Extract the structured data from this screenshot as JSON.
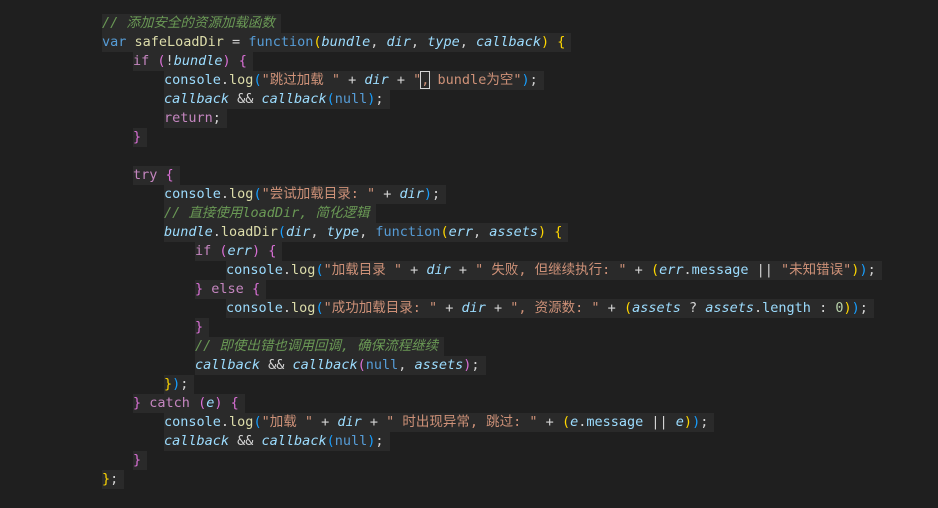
{
  "editor": {
    "language": "javascript",
    "lines": [
      {
        "indent": 1,
        "tokens": [
          {
            "t": "// 添加安全的资源加载函数",
            "c": "cmt"
          }
        ]
      },
      {
        "indent": 1,
        "tokens": [
          {
            "t": "var ",
            "c": "kwb"
          },
          {
            "t": "safeLoadDir",
            "c": "fn"
          },
          {
            "t": " = ",
            "c": "op"
          },
          {
            "t": "function",
            "c": "kwb"
          },
          {
            "t": "(",
            "c": "b1"
          },
          {
            "t": "bundle",
            "c": "param"
          },
          {
            "t": ", ",
            "c": "punc"
          },
          {
            "t": "dir",
            "c": "param"
          },
          {
            "t": ", ",
            "c": "punc"
          },
          {
            "t": "type",
            "c": "param"
          },
          {
            "t": ", ",
            "c": "punc"
          },
          {
            "t": "callback",
            "c": "param"
          },
          {
            "t": ")",
            "c": "b1"
          },
          {
            "t": " ",
            "c": "punc"
          },
          {
            "t": "{",
            "c": "b1"
          }
        ]
      },
      {
        "indent": 2,
        "tokens": [
          {
            "t": "if",
            "c": "kw"
          },
          {
            "t": " ",
            "c": "punc"
          },
          {
            "t": "(",
            "c": "b2"
          },
          {
            "t": "!",
            "c": "op"
          },
          {
            "t": "bundle",
            "c": "param"
          },
          {
            "t": ")",
            "c": "b2"
          },
          {
            "t": " ",
            "c": "punc"
          },
          {
            "t": "{",
            "c": "b2"
          }
        ]
      },
      {
        "indent": 3,
        "tokens": [
          {
            "t": "console",
            "c": "var"
          },
          {
            "t": ".",
            "c": "punc"
          },
          {
            "t": "log",
            "c": "fn"
          },
          {
            "t": "(",
            "c": "b3"
          },
          {
            "t": "\"跳过加载 \"",
            "c": "str"
          },
          {
            "t": " + ",
            "c": "op"
          },
          {
            "t": "dir",
            "c": "param"
          },
          {
            "t": " + ",
            "c": "op"
          },
          {
            "t": "\"",
            "c": "str"
          },
          {
            "t": ",",
            "c": "str",
            "box": true
          },
          {
            "t": " bundle为空\"",
            "c": "str"
          },
          {
            "t": ")",
            "c": "b3"
          },
          {
            "t": ";",
            "c": "punc"
          }
        ]
      },
      {
        "indent": 3,
        "tokens": [
          {
            "t": "callback",
            "c": "param"
          },
          {
            "t": " && ",
            "c": "op"
          },
          {
            "t": "callback",
            "c": "param"
          },
          {
            "t": "(",
            "c": "b3"
          },
          {
            "t": "null",
            "c": "kwb"
          },
          {
            "t": ")",
            "c": "b3"
          },
          {
            "t": ";",
            "c": "punc"
          }
        ]
      },
      {
        "indent": 3,
        "tokens": [
          {
            "t": "return",
            "c": "kw"
          },
          {
            "t": ";",
            "c": "punc"
          }
        ]
      },
      {
        "indent": 2,
        "tokens": [
          {
            "t": "}",
            "c": "b2"
          }
        ]
      },
      {
        "indent": 2,
        "blank": true,
        "tokens": []
      },
      {
        "indent": 2,
        "tokens": [
          {
            "t": "try",
            "c": "kw"
          },
          {
            "t": " ",
            "c": "punc"
          },
          {
            "t": "{",
            "c": "b2"
          }
        ]
      },
      {
        "indent": 3,
        "tokens": [
          {
            "t": "console",
            "c": "var"
          },
          {
            "t": ".",
            "c": "punc"
          },
          {
            "t": "log",
            "c": "fn"
          },
          {
            "t": "(",
            "c": "b3"
          },
          {
            "t": "\"尝试加载目录: \"",
            "c": "str"
          },
          {
            "t": " + ",
            "c": "op"
          },
          {
            "t": "dir",
            "c": "param"
          },
          {
            "t": ")",
            "c": "b3"
          },
          {
            "t": ";",
            "c": "punc"
          }
        ]
      },
      {
        "indent": 3,
        "tokens": [
          {
            "t": "// 直接使用loadDir, 简化逻辑",
            "c": "cmt"
          }
        ]
      },
      {
        "indent": 3,
        "tokens": [
          {
            "t": "bundle",
            "c": "param"
          },
          {
            "t": ".",
            "c": "punc"
          },
          {
            "t": "loadDir",
            "c": "fn"
          },
          {
            "t": "(",
            "c": "b3"
          },
          {
            "t": "dir",
            "c": "param"
          },
          {
            "t": ", ",
            "c": "punc"
          },
          {
            "t": "type",
            "c": "param"
          },
          {
            "t": ", ",
            "c": "punc"
          },
          {
            "t": "function",
            "c": "kwb"
          },
          {
            "t": "(",
            "c": "b1"
          },
          {
            "t": "err",
            "c": "param"
          },
          {
            "t": ", ",
            "c": "punc"
          },
          {
            "t": "assets",
            "c": "param"
          },
          {
            "t": ")",
            "c": "b1"
          },
          {
            "t": " ",
            "c": "punc"
          },
          {
            "t": "{",
            "c": "b1"
          }
        ]
      },
      {
        "indent": 4,
        "tokens": [
          {
            "t": "if",
            "c": "kw"
          },
          {
            "t": " ",
            "c": "punc"
          },
          {
            "t": "(",
            "c": "b2"
          },
          {
            "t": "err",
            "c": "param"
          },
          {
            "t": ")",
            "c": "b2"
          },
          {
            "t": " ",
            "c": "punc"
          },
          {
            "t": "{",
            "c": "b2"
          }
        ]
      },
      {
        "indent": 5,
        "tokens": [
          {
            "t": "console",
            "c": "var"
          },
          {
            "t": ".",
            "c": "punc"
          },
          {
            "t": "log",
            "c": "fn"
          },
          {
            "t": "(",
            "c": "b3"
          },
          {
            "t": "\"加载目录 \"",
            "c": "str"
          },
          {
            "t": " + ",
            "c": "op"
          },
          {
            "t": "dir",
            "c": "param"
          },
          {
            "t": " + ",
            "c": "op"
          },
          {
            "t": "\" 失败, 但继续执行: \"",
            "c": "str"
          },
          {
            "t": " + ",
            "c": "op"
          },
          {
            "t": "(",
            "c": "b1"
          },
          {
            "t": "err",
            "c": "param"
          },
          {
            "t": ".",
            "c": "punc"
          },
          {
            "t": "message",
            "c": "prop"
          },
          {
            "t": " || ",
            "c": "op"
          },
          {
            "t": "\"未知错误\"",
            "c": "str"
          },
          {
            "t": ")",
            "c": "b1"
          },
          {
            "t": ")",
            "c": "b3"
          },
          {
            "t": ";",
            "c": "punc"
          }
        ]
      },
      {
        "indent": 4,
        "tokens": [
          {
            "t": "}",
            "c": "b2"
          },
          {
            "t": " ",
            "c": "punc"
          },
          {
            "t": "else",
            "c": "kw"
          },
          {
            "t": " ",
            "c": "punc"
          },
          {
            "t": "{",
            "c": "b2"
          }
        ]
      },
      {
        "indent": 5,
        "tokens": [
          {
            "t": "console",
            "c": "var"
          },
          {
            "t": ".",
            "c": "punc"
          },
          {
            "t": "log",
            "c": "fn"
          },
          {
            "t": "(",
            "c": "b3"
          },
          {
            "t": "\"成功加载目录: \"",
            "c": "str"
          },
          {
            "t": " + ",
            "c": "op"
          },
          {
            "t": "dir",
            "c": "param"
          },
          {
            "t": " + ",
            "c": "op"
          },
          {
            "t": "\", 资源数: \"",
            "c": "str"
          },
          {
            "t": " + ",
            "c": "op"
          },
          {
            "t": "(",
            "c": "b1"
          },
          {
            "t": "assets",
            "c": "param"
          },
          {
            "t": " ? ",
            "c": "op"
          },
          {
            "t": "assets",
            "c": "param"
          },
          {
            "t": ".",
            "c": "punc"
          },
          {
            "t": "length",
            "c": "prop"
          },
          {
            "t": " : ",
            "c": "op"
          },
          {
            "t": "0",
            "c": "num"
          },
          {
            "t": ")",
            "c": "b1"
          },
          {
            "t": ")",
            "c": "b3"
          },
          {
            "t": ";",
            "c": "punc"
          }
        ]
      },
      {
        "indent": 4,
        "tokens": [
          {
            "t": "}",
            "c": "b2"
          }
        ]
      },
      {
        "indent": 4,
        "tokens": [
          {
            "t": "// 即使出错也调用回调, 确保流程继续",
            "c": "cmt"
          }
        ]
      },
      {
        "indent": 4,
        "tokens": [
          {
            "t": "callback",
            "c": "param"
          },
          {
            "t": " && ",
            "c": "op"
          },
          {
            "t": "callback",
            "c": "param"
          },
          {
            "t": "(",
            "c": "b2"
          },
          {
            "t": "null",
            "c": "kwb"
          },
          {
            "t": ", ",
            "c": "punc"
          },
          {
            "t": "assets",
            "c": "param"
          },
          {
            "t": ")",
            "c": "b2"
          },
          {
            "t": ";",
            "c": "punc"
          }
        ]
      },
      {
        "indent": 3,
        "tokens": [
          {
            "t": "}",
            "c": "b1"
          },
          {
            "t": ")",
            "c": "b3"
          },
          {
            "t": ";",
            "c": "punc"
          }
        ]
      },
      {
        "indent": 2,
        "tokens": [
          {
            "t": "}",
            "c": "b2"
          },
          {
            "t": " ",
            "c": "punc"
          },
          {
            "t": "catch",
            "c": "kw"
          },
          {
            "t": " ",
            "c": "punc"
          },
          {
            "t": "(",
            "c": "b2"
          },
          {
            "t": "e",
            "c": "param"
          },
          {
            "t": ")",
            "c": "b2"
          },
          {
            "t": " ",
            "c": "punc"
          },
          {
            "t": "{",
            "c": "b2"
          }
        ]
      },
      {
        "indent": 3,
        "tokens": [
          {
            "t": "console",
            "c": "var"
          },
          {
            "t": ".",
            "c": "punc"
          },
          {
            "t": "log",
            "c": "fn"
          },
          {
            "t": "(",
            "c": "b3"
          },
          {
            "t": "\"加载 \"",
            "c": "str"
          },
          {
            "t": " + ",
            "c": "op"
          },
          {
            "t": "dir",
            "c": "param"
          },
          {
            "t": " + ",
            "c": "op"
          },
          {
            "t": "\" 时出现异常, 跳过: \"",
            "c": "str"
          },
          {
            "t": " + ",
            "c": "op"
          },
          {
            "t": "(",
            "c": "b1"
          },
          {
            "t": "e",
            "c": "param"
          },
          {
            "t": ".",
            "c": "punc"
          },
          {
            "t": "message",
            "c": "prop"
          },
          {
            "t": " || ",
            "c": "op"
          },
          {
            "t": "e",
            "c": "param"
          },
          {
            "t": ")",
            "c": "b1"
          },
          {
            "t": ")",
            "c": "b3"
          },
          {
            "t": ";",
            "c": "punc"
          }
        ]
      },
      {
        "indent": 3,
        "tokens": [
          {
            "t": "callback",
            "c": "param"
          },
          {
            "t": " && ",
            "c": "op"
          },
          {
            "t": "callback",
            "c": "param"
          },
          {
            "t": "(",
            "c": "b3"
          },
          {
            "t": "null",
            "c": "kwb"
          },
          {
            "t": ")",
            "c": "b3"
          },
          {
            "t": ";",
            "c": "punc"
          }
        ]
      },
      {
        "indent": 2,
        "tokens": [
          {
            "t": "}",
            "c": "b2"
          }
        ]
      },
      {
        "indent": 1,
        "tokens": [
          {
            "t": "}",
            "c": "b1"
          },
          {
            "t": ";",
            "c": "punc"
          }
        ]
      }
    ]
  }
}
